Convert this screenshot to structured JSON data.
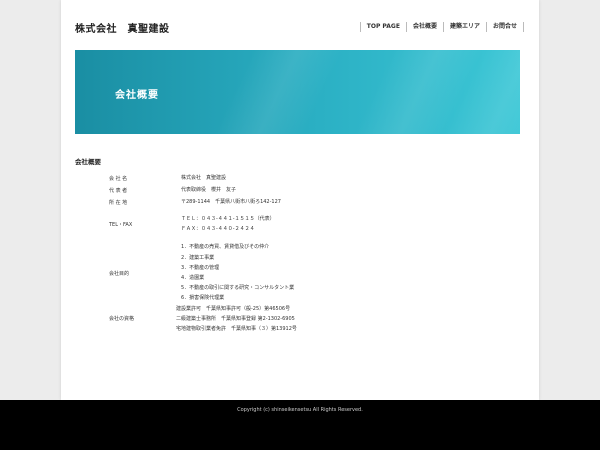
{
  "site": {
    "title": "株式会社　真聖建設"
  },
  "nav": [
    "TOP PAGE",
    "会社概要",
    "建築エリア",
    "お問合せ"
  ],
  "hero": {
    "title": "会社概要"
  },
  "section": {
    "heading": "会社概要"
  },
  "company_info": [
    {
      "label": "会 社 名",
      "lines": [
        "株式会社　真聖建設"
      ]
    },
    {
      "label": "代 表 者",
      "lines": [
        "代表取締役　櫻井　友子"
      ]
    },
    {
      "label": "所 在 地",
      "lines": [
        "〒289-1144　千葉県八街市八街ろ142-127"
      ]
    },
    {
      "label": "TEL・FAX",
      "lines": [
        "ＴＥＬ：０４３-４４１-１５１５（代表）",
        "ＦＡＸ：０４３-４４０-２４２４"
      ]
    },
    {
      "label": "会社目的",
      "lines": [
        "1．不動産の売買、賃貸借及びその仲介",
        "2．建築工事業",
        "3．不動産の管理",
        "4．造園業",
        "5．不動産の取引に関する研究・コンサルタント業",
        "6．損害保険代理業"
      ]
    },
    {
      "label": "会社の資格",
      "lines": [
        "建設業許可　千葉県知事許可（般-25）第46506号",
        "二級建築士事務所　千葉県知事登録 第2-1302-6905",
        "宅地建物取引業者免許　千葉県知事（３）第13912号"
      ]
    }
  ],
  "footer": {
    "copyright": "Copyright (c) shinseikensetsu All Rights Reserved."
  }
}
